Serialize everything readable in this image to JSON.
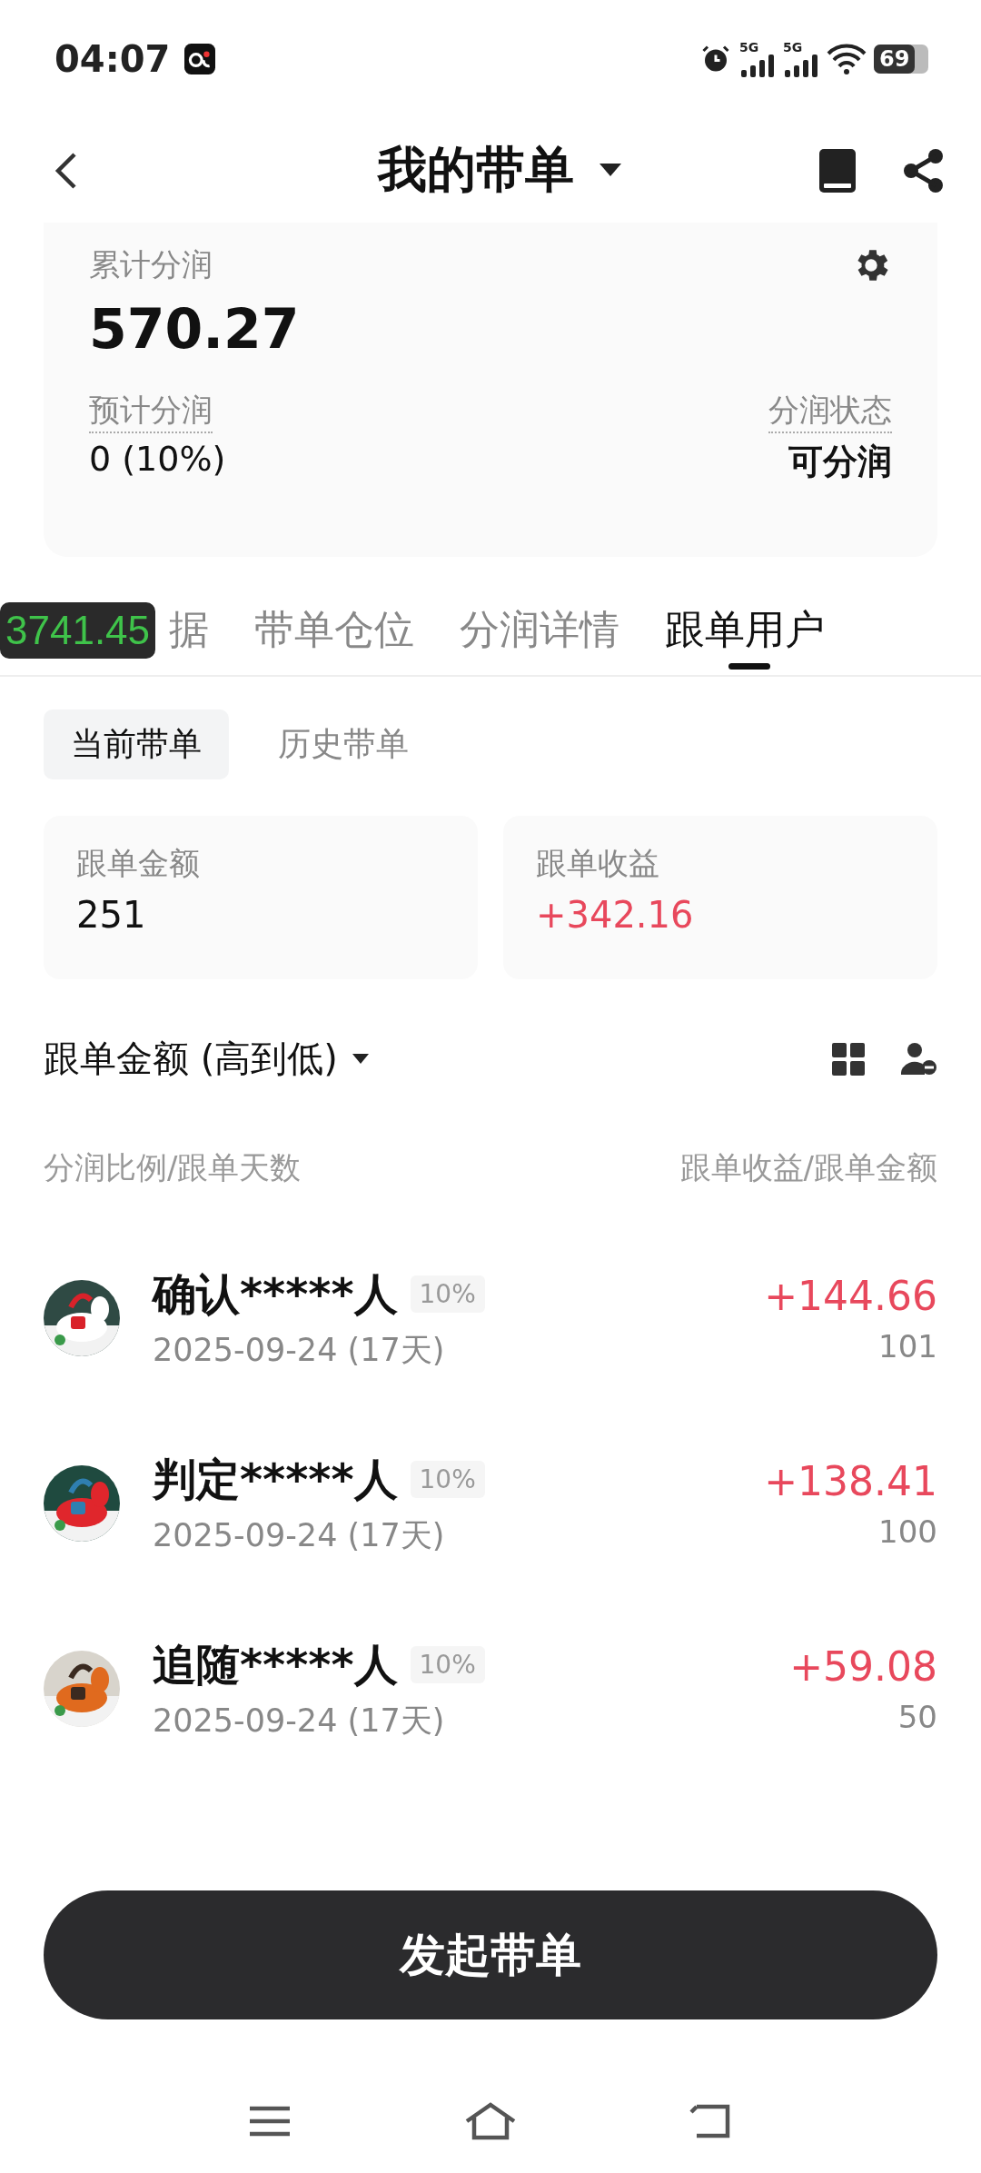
{
  "status_bar": {
    "time": "04:07",
    "network_1": "5G",
    "network_2": "5G",
    "battery": "69"
  },
  "header": {
    "title": "我的带单"
  },
  "summary": {
    "total_label": "累计分润",
    "total_value": "570.27",
    "expected_label": "预计分润",
    "expected_value": "0 (10%)",
    "status_label": "分润状态",
    "status_value": "可分润"
  },
  "overlay": {
    "value": "3741.45"
  },
  "tabs": [
    {
      "label": "据",
      "selected": false
    },
    {
      "label": "带单仓位",
      "selected": false
    },
    {
      "label": "分润详情",
      "selected": false
    },
    {
      "label": "跟单用户",
      "selected": true
    }
  ],
  "segments": [
    {
      "label": "当前带单",
      "selected": true
    },
    {
      "label": "历史带单",
      "selected": false
    }
  ],
  "stats": [
    {
      "label": "跟单金额",
      "value": "251",
      "positive": false
    },
    {
      "label": "跟单收益",
      "value": "+342.16",
      "positive": true
    }
  ],
  "sort": {
    "label": "跟单金额 (高到低)"
  },
  "list_header": {
    "left": "分润比例/跟单天数",
    "right": "跟单收益/跟单金额"
  },
  "followers": [
    {
      "name": "确认*****人",
      "ratio": "10%",
      "date": "2025-09-24 (17天)",
      "profit": "+144.66",
      "amount": "101"
    },
    {
      "name": "判定*****人",
      "ratio": "10%",
      "date": "2025-09-24 (17天)",
      "profit": "+138.41",
      "amount": "100"
    },
    {
      "name": "追随*****人",
      "ratio": "10%",
      "date": "2025-09-24 (17天)",
      "profit": "+59.08",
      "amount": "50"
    }
  ],
  "action_button": "发起带单"
}
